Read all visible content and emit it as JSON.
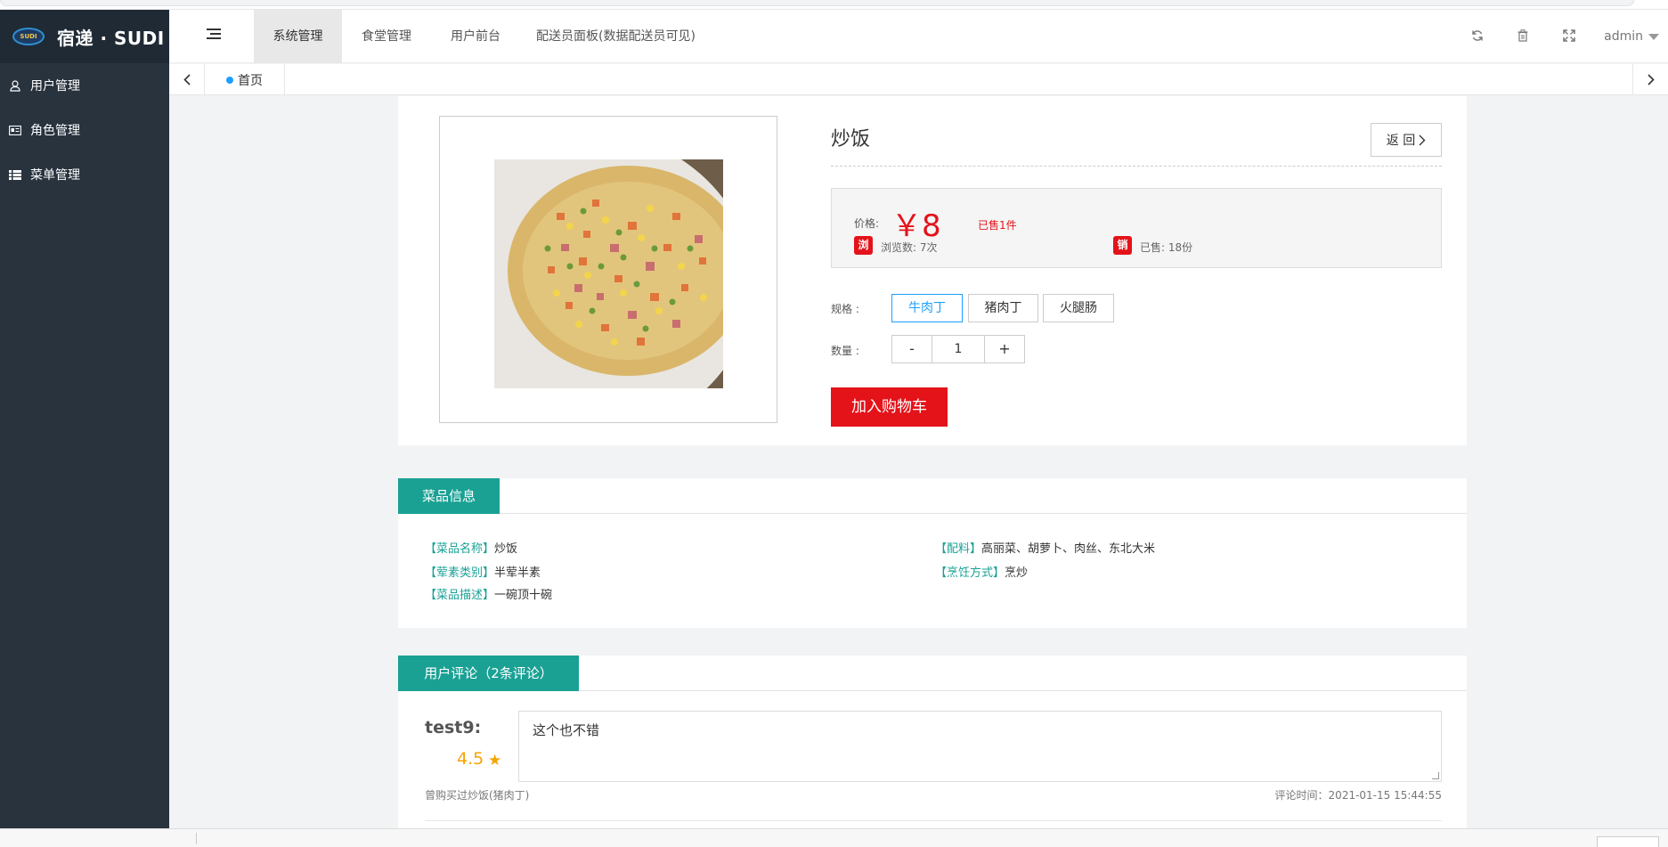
{
  "brand": {
    "logo_badge": "SUDI",
    "name": "宿递 · SUDI"
  },
  "sidebar": {
    "items": [
      {
        "label": "用户管理",
        "icon": "user-icon"
      },
      {
        "label": "角色管理",
        "icon": "id-card-icon"
      },
      {
        "label": "菜单管理",
        "icon": "list-icon"
      }
    ]
  },
  "header": {
    "tabs": [
      "系统管理",
      "食堂管理",
      "用户前台",
      "配送员面板(数据配送员可见)"
    ],
    "active_tab": "系统管理",
    "user": "admin"
  },
  "tabbar": {
    "home": "首页"
  },
  "product": {
    "title": "炒饭",
    "back": "返 回",
    "price_label": "价格:",
    "price": "￥8",
    "sold_count_text": "已售1件",
    "views_badge": "浏",
    "views": "浏览数: 7次",
    "sales_badge": "销",
    "sales": "已售: 18份",
    "spec_label": "规格 :",
    "specs": [
      "牛肉丁",
      "猪肉丁",
      "火腿肠"
    ],
    "selected_spec": "牛肉丁",
    "qty_label": "数量 :",
    "qty_minus": "-",
    "qty": "1",
    "qty_plus": "+",
    "add_to_cart": "加入购物车"
  },
  "info": {
    "section_title": "菜品信息",
    "name_key": "【菜品名称】",
    "name_val": "炒饭",
    "ingredients_key": "【配料】",
    "ingredients_val": "高丽菜、胡萝卜、肉丝、东北大米",
    "type_key": "【荤素类别】",
    "type_val": "半荤半素",
    "cook_key": "【烹饪方式】",
    "cook_val": "烹炒",
    "desc_key": "【菜品描述】",
    "desc_val": "一碗顶十碗"
  },
  "comments": {
    "section_title": "用户评论（2条评论）",
    "items": [
      {
        "user": "test9:",
        "score": "4.5",
        "text": "这个也不错",
        "bought": "曾购买过炒饭(猪肉丁)",
        "time": "评论时间：2021-01-15 15:44:55"
      }
    ]
  },
  "colors": {
    "accent_red": "#e4131a",
    "teal": "#1aa194",
    "blue": "#1e9fff",
    "sidebar_bg": "#28333e",
    "star": "#f6a400"
  }
}
